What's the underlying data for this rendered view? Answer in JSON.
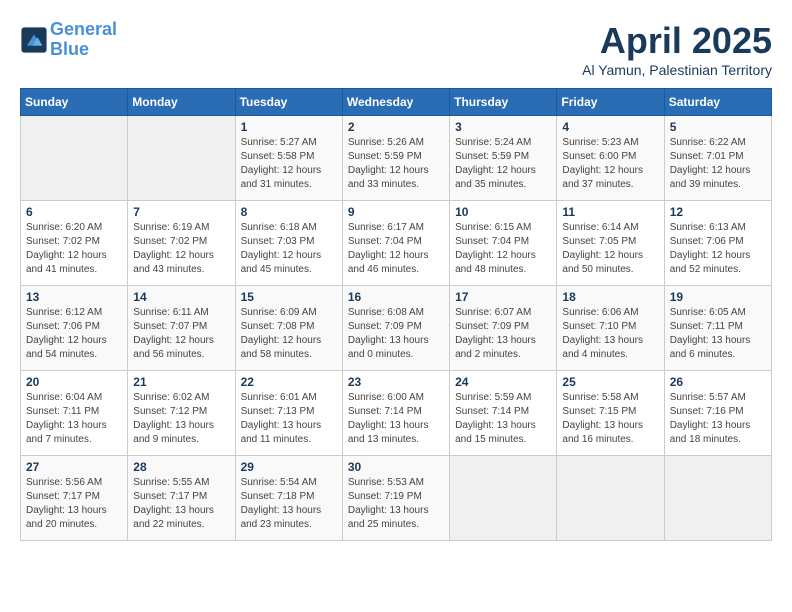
{
  "header": {
    "logo_line1": "General",
    "logo_line2": "Blue",
    "month_title": "April 2025",
    "subtitle": "Al Yamun, Palestinian Territory"
  },
  "weekdays": [
    "Sunday",
    "Monday",
    "Tuesday",
    "Wednesday",
    "Thursday",
    "Friday",
    "Saturday"
  ],
  "weeks": [
    [
      {
        "day": "",
        "info": ""
      },
      {
        "day": "",
        "info": ""
      },
      {
        "day": "1",
        "info": "Sunrise: 5:27 AM\nSunset: 5:58 PM\nDaylight: 12 hours and 31 minutes."
      },
      {
        "day": "2",
        "info": "Sunrise: 5:26 AM\nSunset: 5:59 PM\nDaylight: 12 hours and 33 minutes."
      },
      {
        "day": "3",
        "info": "Sunrise: 5:24 AM\nSunset: 5:59 PM\nDaylight: 12 hours and 35 minutes."
      },
      {
        "day": "4",
        "info": "Sunrise: 5:23 AM\nSunset: 6:00 PM\nDaylight: 12 hours and 37 minutes."
      },
      {
        "day": "5",
        "info": "Sunrise: 6:22 AM\nSunset: 7:01 PM\nDaylight: 12 hours and 39 minutes."
      }
    ],
    [
      {
        "day": "6",
        "info": "Sunrise: 6:20 AM\nSunset: 7:02 PM\nDaylight: 12 hours and 41 minutes."
      },
      {
        "day": "7",
        "info": "Sunrise: 6:19 AM\nSunset: 7:02 PM\nDaylight: 12 hours and 43 minutes."
      },
      {
        "day": "8",
        "info": "Sunrise: 6:18 AM\nSunset: 7:03 PM\nDaylight: 12 hours and 45 minutes."
      },
      {
        "day": "9",
        "info": "Sunrise: 6:17 AM\nSunset: 7:04 PM\nDaylight: 12 hours and 46 minutes."
      },
      {
        "day": "10",
        "info": "Sunrise: 6:15 AM\nSunset: 7:04 PM\nDaylight: 12 hours and 48 minutes."
      },
      {
        "day": "11",
        "info": "Sunrise: 6:14 AM\nSunset: 7:05 PM\nDaylight: 12 hours and 50 minutes."
      },
      {
        "day": "12",
        "info": "Sunrise: 6:13 AM\nSunset: 7:06 PM\nDaylight: 12 hours and 52 minutes."
      }
    ],
    [
      {
        "day": "13",
        "info": "Sunrise: 6:12 AM\nSunset: 7:06 PM\nDaylight: 12 hours and 54 minutes."
      },
      {
        "day": "14",
        "info": "Sunrise: 6:11 AM\nSunset: 7:07 PM\nDaylight: 12 hours and 56 minutes."
      },
      {
        "day": "15",
        "info": "Sunrise: 6:09 AM\nSunset: 7:08 PM\nDaylight: 12 hours and 58 minutes."
      },
      {
        "day": "16",
        "info": "Sunrise: 6:08 AM\nSunset: 7:09 PM\nDaylight: 13 hours and 0 minutes."
      },
      {
        "day": "17",
        "info": "Sunrise: 6:07 AM\nSunset: 7:09 PM\nDaylight: 13 hours and 2 minutes."
      },
      {
        "day": "18",
        "info": "Sunrise: 6:06 AM\nSunset: 7:10 PM\nDaylight: 13 hours and 4 minutes."
      },
      {
        "day": "19",
        "info": "Sunrise: 6:05 AM\nSunset: 7:11 PM\nDaylight: 13 hours and 6 minutes."
      }
    ],
    [
      {
        "day": "20",
        "info": "Sunrise: 6:04 AM\nSunset: 7:11 PM\nDaylight: 13 hours and 7 minutes."
      },
      {
        "day": "21",
        "info": "Sunrise: 6:02 AM\nSunset: 7:12 PM\nDaylight: 13 hours and 9 minutes."
      },
      {
        "day": "22",
        "info": "Sunrise: 6:01 AM\nSunset: 7:13 PM\nDaylight: 13 hours and 11 minutes."
      },
      {
        "day": "23",
        "info": "Sunrise: 6:00 AM\nSunset: 7:14 PM\nDaylight: 13 hours and 13 minutes."
      },
      {
        "day": "24",
        "info": "Sunrise: 5:59 AM\nSunset: 7:14 PM\nDaylight: 13 hours and 15 minutes."
      },
      {
        "day": "25",
        "info": "Sunrise: 5:58 AM\nSunset: 7:15 PM\nDaylight: 13 hours and 16 minutes."
      },
      {
        "day": "26",
        "info": "Sunrise: 5:57 AM\nSunset: 7:16 PM\nDaylight: 13 hours and 18 minutes."
      }
    ],
    [
      {
        "day": "27",
        "info": "Sunrise: 5:56 AM\nSunset: 7:17 PM\nDaylight: 13 hours and 20 minutes."
      },
      {
        "day": "28",
        "info": "Sunrise: 5:55 AM\nSunset: 7:17 PM\nDaylight: 13 hours and 22 minutes."
      },
      {
        "day": "29",
        "info": "Sunrise: 5:54 AM\nSunset: 7:18 PM\nDaylight: 13 hours and 23 minutes."
      },
      {
        "day": "30",
        "info": "Sunrise: 5:53 AM\nSunset: 7:19 PM\nDaylight: 13 hours and 25 minutes."
      },
      {
        "day": "",
        "info": ""
      },
      {
        "day": "",
        "info": ""
      },
      {
        "day": "",
        "info": ""
      }
    ]
  ]
}
